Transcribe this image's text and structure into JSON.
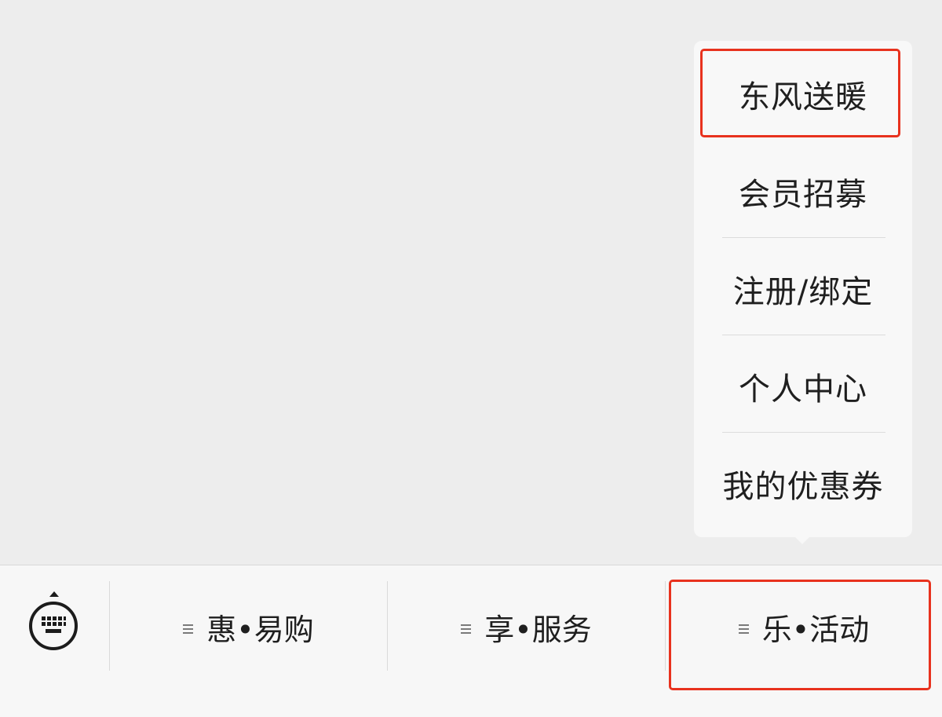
{
  "popup_menu": {
    "items": [
      {
        "label": "东风送暖",
        "highlighted": true
      },
      {
        "label": "会员招募"
      },
      {
        "label": "注册/绑定"
      },
      {
        "label": "个人中心"
      },
      {
        "label": "我的优惠券"
      }
    ]
  },
  "bottom_menu": {
    "keyboard_icon": "keyboard-toggle-icon",
    "tabs": [
      {
        "label": "惠•易购",
        "icon": "menu-lines-icon"
      },
      {
        "label": "享•服务",
        "icon": "menu-lines-icon"
      },
      {
        "label": "乐•活动",
        "icon": "menu-lines-icon",
        "highlighted": true
      }
    ]
  },
  "colors": {
    "highlight": "#e8321e",
    "background": "#ededed",
    "bar_background": "#f7f7f7"
  }
}
